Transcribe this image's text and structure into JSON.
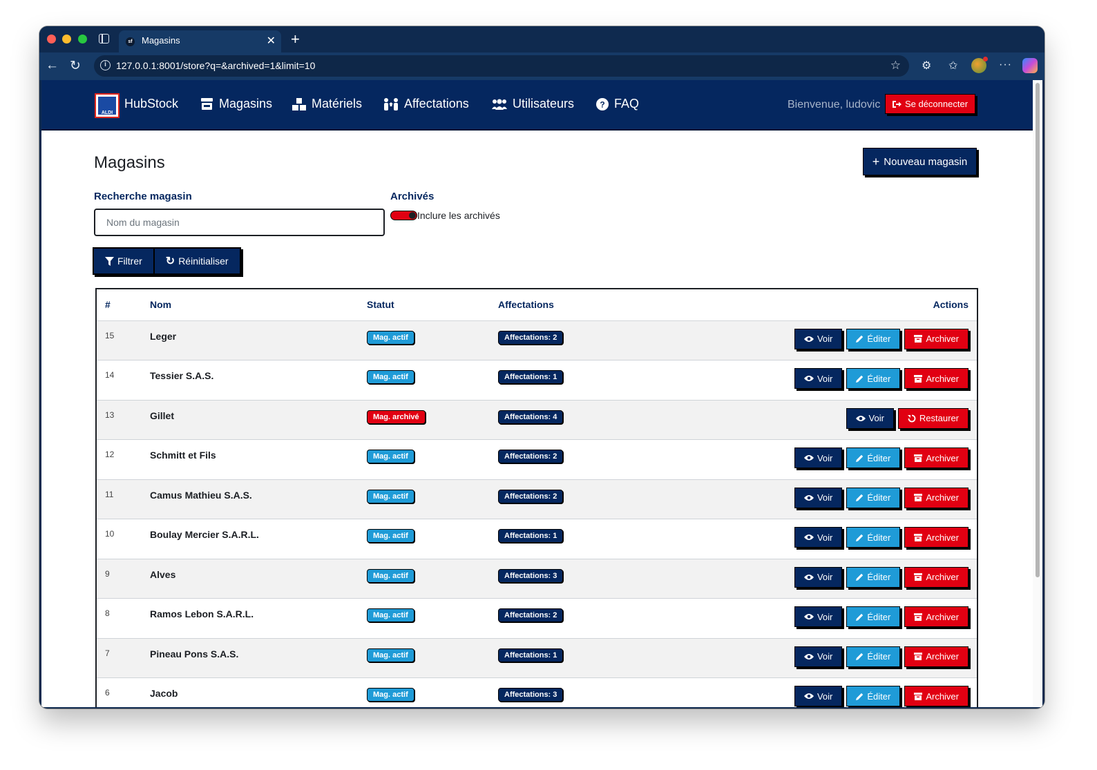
{
  "browser": {
    "tab_title": "Magasins",
    "tab_favicon": "sf",
    "url": "127.0.0.1:8001/store?q=&archived=1&limit=10"
  },
  "nav": {
    "brand": "HubStock",
    "logo_text": "ALDI",
    "links": [
      {
        "label": "Magasins",
        "icon": "store-icon"
      },
      {
        "label": "Matériels",
        "icon": "boxes-icon"
      },
      {
        "label": "Affectations",
        "icon": "people-arrows-icon"
      },
      {
        "label": "Utilisateurs",
        "icon": "users-icon"
      },
      {
        "label": "FAQ",
        "icon": "question-circle-icon"
      }
    ],
    "welcome": "Bienvenue, ludovic",
    "logout_label": "Se déconnecter"
  },
  "page": {
    "title": "Magasins",
    "new_button": "Nouveau magasin",
    "search_label": "Recherche magasin",
    "search_placeholder": "Nom du magasin",
    "search_value": "",
    "archived_label": "Archivés",
    "archived_toggle_label": "Inclure les archivés",
    "archived_checked": true,
    "filter_button": "Filtrer",
    "reset_button": "Réinitialiser"
  },
  "table": {
    "headers": {
      "id": "#",
      "name": "Nom",
      "status": "Statut",
      "assignments": "Affectations",
      "actions": "Actions"
    },
    "action_labels": {
      "view": "Voir",
      "edit": "Éditer",
      "archive": "Archiver",
      "restore": "Restaurer"
    },
    "rows": [
      {
        "id": "15",
        "name": "Leger",
        "status": "Mag. actif",
        "archived": false,
        "assignments": "Affectations: 2"
      },
      {
        "id": "14",
        "name": "Tessier S.A.S.",
        "status": "Mag. actif",
        "archived": false,
        "assignments": "Affectations: 1"
      },
      {
        "id": "13",
        "name": "Gillet",
        "status": "Mag. archivé",
        "archived": true,
        "assignments": "Affectations: 4"
      },
      {
        "id": "12",
        "name": "Schmitt et Fils",
        "status": "Mag. actif",
        "archived": false,
        "assignments": "Affectations: 2"
      },
      {
        "id": "11",
        "name": "Camus Mathieu S.A.S.",
        "status": "Mag. actif",
        "archived": false,
        "assignments": "Affectations: 2"
      },
      {
        "id": "10",
        "name": "Boulay Mercier S.A.R.L.",
        "status": "Mag. actif",
        "archived": false,
        "assignments": "Affectations: 1"
      },
      {
        "id": "9",
        "name": "Alves",
        "status": "Mag. actif",
        "archived": false,
        "assignments": "Affectations: 3"
      },
      {
        "id": "8",
        "name": "Ramos Lebon S.A.R.L.",
        "status": "Mag. actif",
        "archived": false,
        "assignments": "Affectations: 2"
      },
      {
        "id": "7",
        "name": "Pineau Pons S.A.S.",
        "status": "Mag. actif",
        "archived": false,
        "assignments": "Affectations: 1"
      },
      {
        "id": "6",
        "name": "Jacob",
        "status": "Mag. actif",
        "archived": false,
        "assignments": "Affectations: 3"
      }
    ]
  },
  "colors": {
    "navy": "#05275f",
    "accent_blue": "#1f9bd7",
    "danger_red": "#e10012"
  }
}
